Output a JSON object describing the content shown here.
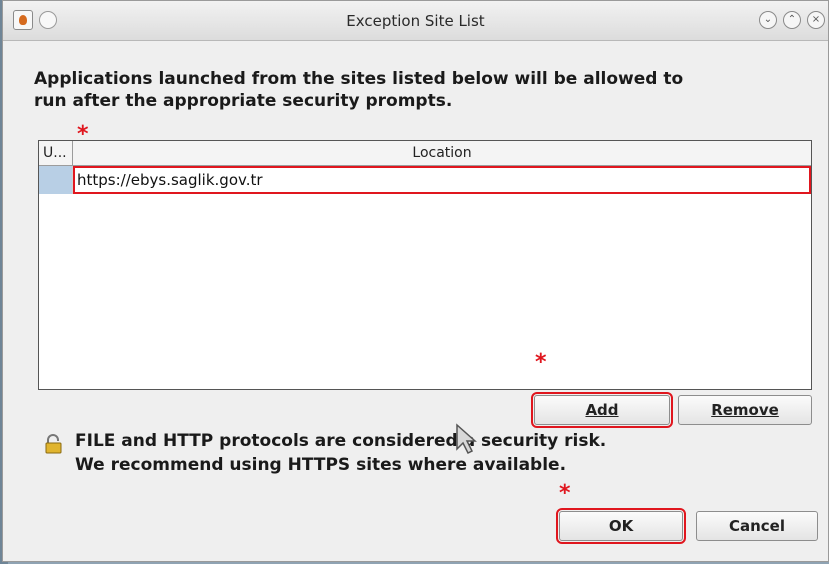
{
  "window": {
    "title": "Exception Site List"
  },
  "dialog": {
    "description_line1": "Applications launched from the sites listed below will be allowed to",
    "description_line2": "run after the appropriate security prompts.",
    "table": {
      "columns": [
        "U...",
        "Location"
      ],
      "rows": [
        {
          "location": "https://ebys.saglik.gov.tr"
        }
      ]
    },
    "buttons": {
      "add": "Add",
      "remove": "Remove",
      "ok": "OK",
      "cancel": "Cancel"
    },
    "warning_line1": "FILE and HTTP protocols are considered a security risk.",
    "warning_line2": "We recommend using HTTPS sites where available."
  },
  "annotations": {
    "marker": "*"
  },
  "colors": {
    "highlight": "#e0161e",
    "selection": "#b8cfe5"
  },
  "icons": [
    "java-icon",
    "roll-up-icon",
    "minimize-icon",
    "maximize-icon",
    "close-icon",
    "lock-icon",
    "mouse-cursor-icon"
  ]
}
